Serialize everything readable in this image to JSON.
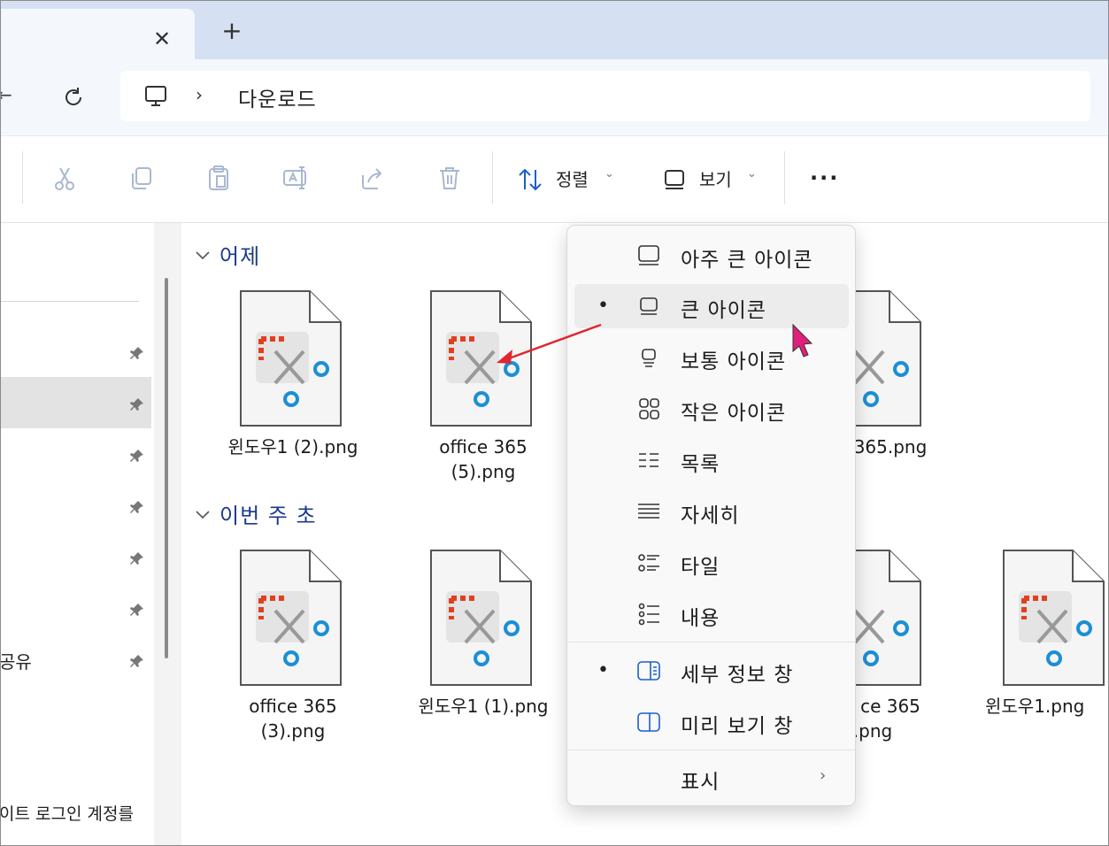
{
  "tabbar": {
    "close_glyph": "✕",
    "newtab_glyph": "+"
  },
  "address": {
    "back_glyph": "←",
    "separator": "›",
    "crumb": "다운로드"
  },
  "toolbar": {
    "sort_label": "정렬",
    "view_label": "보기",
    "more_glyph": "···",
    "chevron": "⌄",
    "icons": [
      "cut-icon",
      "copy-icon",
      "paste-icon",
      "rename-icon",
      "share-icon",
      "delete-icon"
    ]
  },
  "sidebar": {
    "items": [
      {
        "label": "공유",
        "partial": true
      },
      {
        "label": "이트 로그인 계정를",
        "partial": true
      }
    ]
  },
  "groups": {
    "yesterday": {
      "title": "어제",
      "files": [
        {
          "name": "윈도우1 (2).png"
        },
        {
          "name": "office 365 (5).png",
          "line1": "office 365",
          "line2": "(5).png"
        },
        {
          "name": "365.png",
          "partial": true
        }
      ]
    },
    "this_week": {
      "title": "이번 주 초",
      "files": [
        {
          "name": "office 365 (3).png",
          "line1": "office 365",
          "line2": "(3).png"
        },
        {
          "name": "윈도우1 (1).png"
        },
        {
          "name": "ce 365 .png",
          "line1": "ce 365",
          "line2": ".png",
          "partial": true
        },
        {
          "name": "윈도우1.png"
        }
      ]
    }
  },
  "view_menu": {
    "items": [
      {
        "label": "아주 큰 아이콘",
        "icon": "extra-large-icons-icon",
        "selected": false
      },
      {
        "label": "큰 아이콘",
        "icon": "large-icons-icon",
        "selected": true
      },
      {
        "label": "보통 아이콘",
        "icon": "medium-icons-icon",
        "selected": false
      },
      {
        "label": "작은 아이콘",
        "icon": "small-icons-icon",
        "selected": false
      },
      {
        "label": "목록",
        "icon": "list-icon",
        "selected": false
      },
      {
        "label": "자세히",
        "icon": "details-icon",
        "selected": false
      },
      {
        "label": "타일",
        "icon": "tiles-icon",
        "selected": false
      },
      {
        "label": "내용",
        "icon": "content-icon",
        "selected": false
      }
    ],
    "panes": [
      {
        "label": "세부 정보 창",
        "icon": "details-pane-icon",
        "selected": true
      },
      {
        "label": "미리 보기 창",
        "icon": "preview-pane-icon",
        "selected": false
      }
    ],
    "show": {
      "label": "표시",
      "arrow": "›"
    },
    "bullet": "•"
  },
  "colors": {
    "accent": "#1b3a8a",
    "annotation_arrow": "#e0262e",
    "cursor": "#e0207a",
    "tab_bg": "#d5e1f3"
  }
}
